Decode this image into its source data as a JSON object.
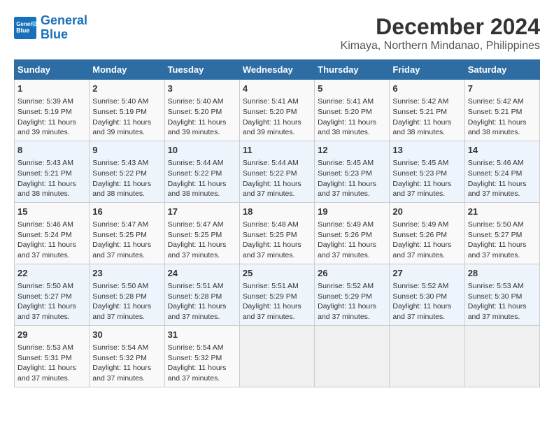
{
  "logo": {
    "line1": "General",
    "line2": "Blue"
  },
  "title": "December 2024",
  "subtitle": "Kimaya, Northern Mindanao, Philippines",
  "days_header": [
    "Sunday",
    "Monday",
    "Tuesday",
    "Wednesday",
    "Thursday",
    "Friday",
    "Saturday"
  ],
  "weeks": [
    [
      {
        "day": "1",
        "rise": "Sunrise: 5:39 AM",
        "set": "Sunset: 5:19 PM",
        "daylight": "Daylight: 11 hours and 39 minutes."
      },
      {
        "day": "2",
        "rise": "Sunrise: 5:40 AM",
        "set": "Sunset: 5:19 PM",
        "daylight": "Daylight: 11 hours and 39 minutes."
      },
      {
        "day": "3",
        "rise": "Sunrise: 5:40 AM",
        "set": "Sunset: 5:20 PM",
        "daylight": "Daylight: 11 hours and 39 minutes."
      },
      {
        "day": "4",
        "rise": "Sunrise: 5:41 AM",
        "set": "Sunset: 5:20 PM",
        "daylight": "Daylight: 11 hours and 39 minutes."
      },
      {
        "day": "5",
        "rise": "Sunrise: 5:41 AM",
        "set": "Sunset: 5:20 PM",
        "daylight": "Daylight: 11 hours and 38 minutes."
      },
      {
        "day": "6",
        "rise": "Sunrise: 5:42 AM",
        "set": "Sunset: 5:21 PM",
        "daylight": "Daylight: 11 hours and 38 minutes."
      },
      {
        "day": "7",
        "rise": "Sunrise: 5:42 AM",
        "set": "Sunset: 5:21 PM",
        "daylight": "Daylight: 11 hours and 38 minutes."
      }
    ],
    [
      {
        "day": "8",
        "rise": "Sunrise: 5:43 AM",
        "set": "Sunset: 5:21 PM",
        "daylight": "Daylight: 11 hours and 38 minutes."
      },
      {
        "day": "9",
        "rise": "Sunrise: 5:43 AM",
        "set": "Sunset: 5:22 PM",
        "daylight": "Daylight: 11 hours and 38 minutes."
      },
      {
        "day": "10",
        "rise": "Sunrise: 5:44 AM",
        "set": "Sunset: 5:22 PM",
        "daylight": "Daylight: 11 hours and 38 minutes."
      },
      {
        "day": "11",
        "rise": "Sunrise: 5:44 AM",
        "set": "Sunset: 5:22 PM",
        "daylight": "Daylight: 11 hours and 37 minutes."
      },
      {
        "day": "12",
        "rise": "Sunrise: 5:45 AM",
        "set": "Sunset: 5:23 PM",
        "daylight": "Daylight: 11 hours and 37 minutes."
      },
      {
        "day": "13",
        "rise": "Sunrise: 5:45 AM",
        "set": "Sunset: 5:23 PM",
        "daylight": "Daylight: 11 hours and 37 minutes."
      },
      {
        "day": "14",
        "rise": "Sunrise: 5:46 AM",
        "set": "Sunset: 5:24 PM",
        "daylight": "Daylight: 11 hours and 37 minutes."
      }
    ],
    [
      {
        "day": "15",
        "rise": "Sunrise: 5:46 AM",
        "set": "Sunset: 5:24 PM",
        "daylight": "Daylight: 11 hours and 37 minutes."
      },
      {
        "day": "16",
        "rise": "Sunrise: 5:47 AM",
        "set": "Sunset: 5:25 PM",
        "daylight": "Daylight: 11 hours and 37 minutes."
      },
      {
        "day": "17",
        "rise": "Sunrise: 5:47 AM",
        "set": "Sunset: 5:25 PM",
        "daylight": "Daylight: 11 hours and 37 minutes."
      },
      {
        "day": "18",
        "rise": "Sunrise: 5:48 AM",
        "set": "Sunset: 5:25 PM",
        "daylight": "Daylight: 11 hours and 37 minutes."
      },
      {
        "day": "19",
        "rise": "Sunrise: 5:49 AM",
        "set": "Sunset: 5:26 PM",
        "daylight": "Daylight: 11 hours and 37 minutes."
      },
      {
        "day": "20",
        "rise": "Sunrise: 5:49 AM",
        "set": "Sunset: 5:26 PM",
        "daylight": "Daylight: 11 hours and 37 minutes."
      },
      {
        "day": "21",
        "rise": "Sunrise: 5:50 AM",
        "set": "Sunset: 5:27 PM",
        "daylight": "Daylight: 11 hours and 37 minutes."
      }
    ],
    [
      {
        "day": "22",
        "rise": "Sunrise: 5:50 AM",
        "set": "Sunset: 5:27 PM",
        "daylight": "Daylight: 11 hours and 37 minutes."
      },
      {
        "day": "23",
        "rise": "Sunrise: 5:50 AM",
        "set": "Sunset: 5:28 PM",
        "daylight": "Daylight: 11 hours and 37 minutes."
      },
      {
        "day": "24",
        "rise": "Sunrise: 5:51 AM",
        "set": "Sunset: 5:28 PM",
        "daylight": "Daylight: 11 hours and 37 minutes."
      },
      {
        "day": "25",
        "rise": "Sunrise: 5:51 AM",
        "set": "Sunset: 5:29 PM",
        "daylight": "Daylight: 11 hours and 37 minutes."
      },
      {
        "day": "26",
        "rise": "Sunrise: 5:52 AM",
        "set": "Sunset: 5:29 PM",
        "daylight": "Daylight: 11 hours and 37 minutes."
      },
      {
        "day": "27",
        "rise": "Sunrise: 5:52 AM",
        "set": "Sunset: 5:30 PM",
        "daylight": "Daylight: 11 hours and 37 minutes."
      },
      {
        "day": "28",
        "rise": "Sunrise: 5:53 AM",
        "set": "Sunset: 5:30 PM",
        "daylight": "Daylight: 11 hours and 37 minutes."
      }
    ],
    [
      {
        "day": "29",
        "rise": "Sunrise: 5:53 AM",
        "set": "Sunset: 5:31 PM",
        "daylight": "Daylight: 11 hours and 37 minutes."
      },
      {
        "day": "30",
        "rise": "Sunrise: 5:54 AM",
        "set": "Sunset: 5:32 PM",
        "daylight": "Daylight: 11 hours and 37 minutes."
      },
      {
        "day": "31",
        "rise": "Sunrise: 5:54 AM",
        "set": "Sunset: 5:32 PM",
        "daylight": "Daylight: 11 hours and 37 minutes."
      },
      null,
      null,
      null,
      null
    ]
  ]
}
